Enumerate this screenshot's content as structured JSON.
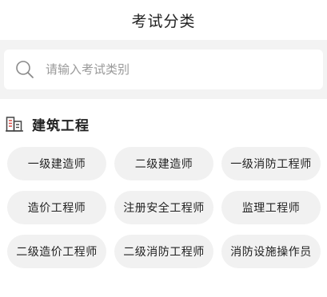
{
  "header": {
    "title": "考试分类"
  },
  "search": {
    "placeholder": "请输入考试类别"
  },
  "section": {
    "icon": "building-icon",
    "title": "建筑工程",
    "icon_color": "#d9534f",
    "items": [
      {
        "label": "一级建造师"
      },
      {
        "label": "二级建造师"
      },
      {
        "label": "一级消防工程师"
      },
      {
        "label": "造价工程师"
      },
      {
        "label": "注册安全工程师"
      },
      {
        "label": "监理工程师"
      },
      {
        "label": "二级造价工程师"
      },
      {
        "label": "二级消防工程师"
      },
      {
        "label": "消防设施操作员"
      }
    ]
  },
  "colors": {
    "background": "#ffffff",
    "search_band": "#f3f3f3",
    "chip_background": "#f1f1f1",
    "text": "#222222",
    "placeholder": "#9a9a9a"
  }
}
